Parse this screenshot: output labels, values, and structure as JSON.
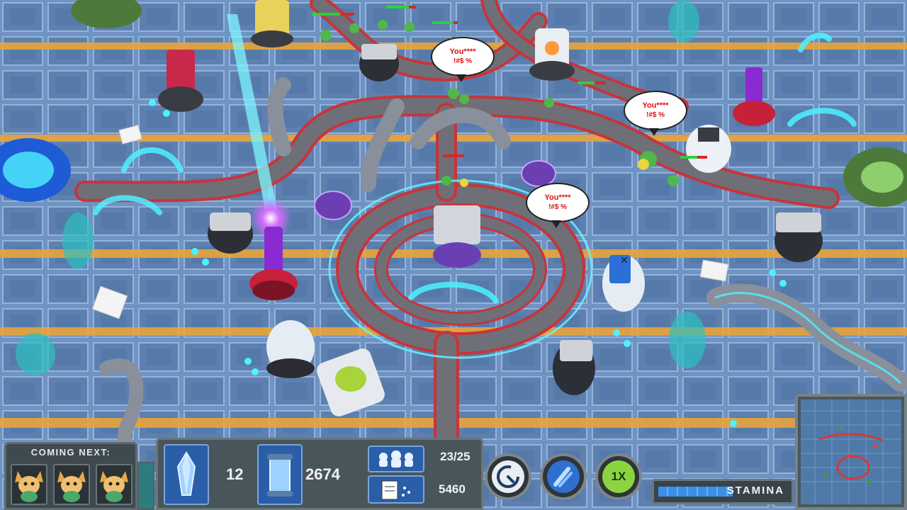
{
  "playfield": {
    "speech_bubbles": [
      {
        "line1": "You****",
        "line2": "!#$ %"
      },
      {
        "line1": "You****",
        "line2": "!#$ %"
      },
      {
        "line1": "You****",
        "line2": "!#$ %"
      }
    ]
  },
  "hud": {
    "coming_next": {
      "title": "COMING NEXT:",
      "slots": [
        "fox-creature-icon",
        "fox-creature-icon",
        "fox-creature-icon"
      ]
    },
    "crystals": {
      "icon": "crystal-icon",
      "value": "12"
    },
    "energy": {
      "icon": "canister-icon",
      "value": "2674"
    },
    "creatures_escaped": {
      "icon": "creature-group-icon",
      "value": "23/25"
    },
    "score": {
      "icon": "notepad-icon",
      "value": "5460"
    },
    "buttons": {
      "timer": {
        "icon": "timer-icon"
      },
      "meteor": {
        "icon": "meteor-icon"
      },
      "speed": {
        "label": "1X"
      }
    },
    "stamina": {
      "label": "STAMINA",
      "fill_fraction": 0.55
    },
    "minimap": {
      "icon": "minimap-icon"
    }
  },
  "colors": {
    "floor": "#5b7fae",
    "track": "#6e6f77",
    "rail": "#c8343a",
    "glow": "#4df1ff",
    "hud_panel": "#48565b",
    "hud_blue": "#2a5ea9",
    "speed_green": "#8bd43f"
  }
}
